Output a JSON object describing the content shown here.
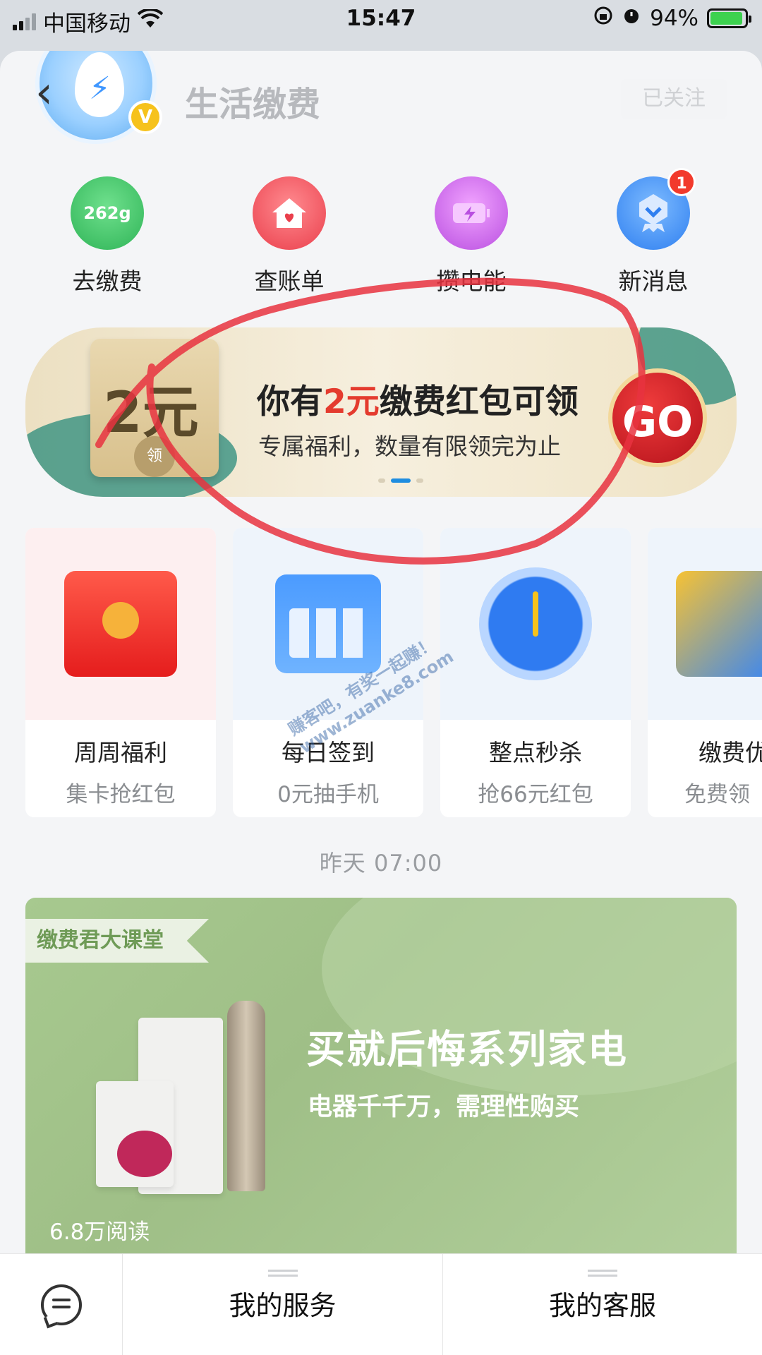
{
  "status_bar": {
    "carrier": "中国移动",
    "time": "15:47",
    "battery": "94%",
    "battery_level": 0.94
  },
  "header": {
    "title": "生活缴费",
    "follow_label": "已关注",
    "verified_badge": "V"
  },
  "quick_menu": [
    {
      "label": "去缴费",
      "icon": "bill-pay-icon",
      "color": "#3ec46a",
      "inner": "262g"
    },
    {
      "label": "查账单",
      "icon": "house-heart-icon",
      "color": "#f0525d"
    },
    {
      "label": "攒电能",
      "icon": "battery-charge-icon",
      "color": "#c86be6"
    },
    {
      "label": "新消息",
      "icon": "medal-message-icon",
      "color": "#3a8ef2",
      "badge": "1"
    }
  ],
  "banner": {
    "text_prefix": "你有",
    "highlight": "2元",
    "text_suffix": "缴费红包可领",
    "subtitle": "专属福利，数量有限领完为止",
    "envelope_amount": "2元",
    "envelope_seal": "领",
    "go_label": "GO"
  },
  "cards": [
    {
      "title": "周周福利",
      "subtitle": "集卡抢红包",
      "icon": "red-envelope-gift-icon",
      "bg": "#fdeff0"
    },
    {
      "title": "每日签到",
      "subtitle": "0元抽手机",
      "icon": "calendar-check-icon",
      "bg": "#eef4fb"
    },
    {
      "title": "整点秒杀",
      "subtitle": "抢66元红包",
      "icon": "clock-timer-icon",
      "bg": "#eef4fb"
    },
    {
      "title": "缴费优",
      "subtitle": "免费领",
      "icon": "coupon-icon",
      "bg": "#eef4fb"
    }
  ],
  "timestamp": "昨天 07:00",
  "article": {
    "tag": "缴费君大课堂",
    "title": "买就后悔系列家电",
    "subtitle": "电器千千万，需理性购买",
    "reads": "6.8万阅读"
  },
  "tab_bar": {
    "service": "我的服务",
    "support": "我的客服"
  },
  "watermark": {
    "line1": "赚客吧，有奖一起赚！",
    "line2": "www.zuanke8.com"
  }
}
